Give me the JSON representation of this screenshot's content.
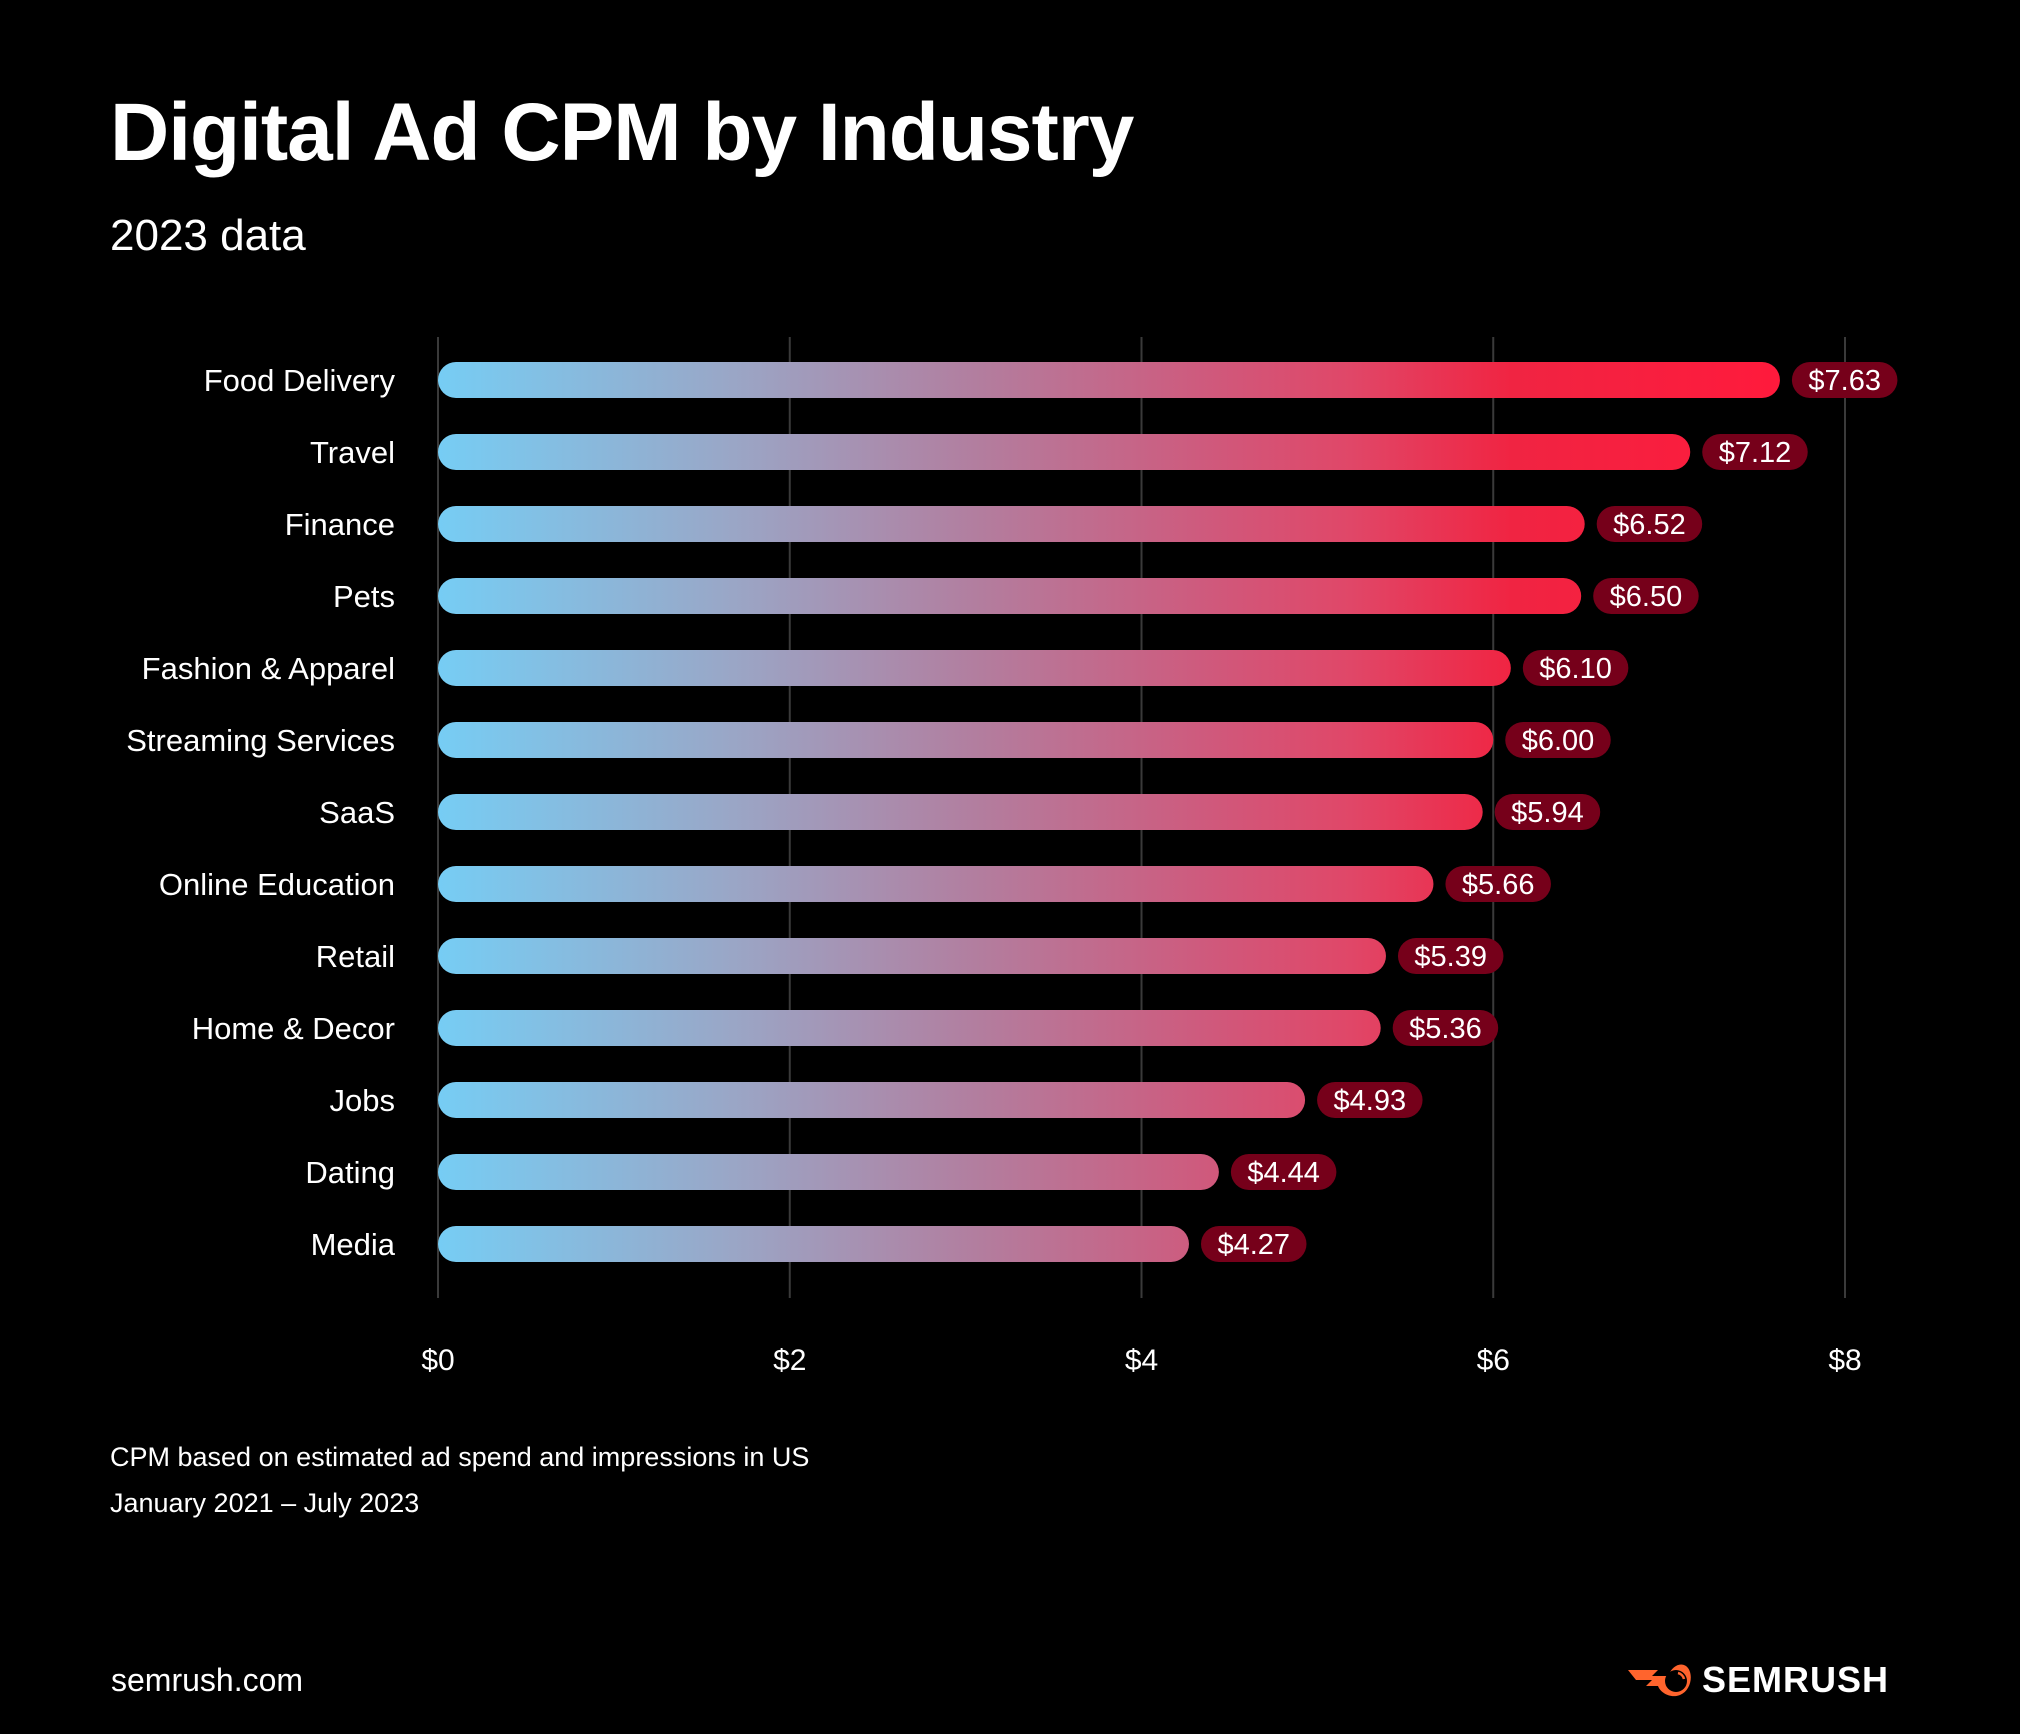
{
  "header": {
    "title": "Digital Ad CPM by Industry",
    "subtitle": "2023 data"
  },
  "chart_data": {
    "type": "bar",
    "orientation": "horizontal",
    "title": "Digital Ad CPM by Industry",
    "subtitle": "2023 data",
    "xlabel": "",
    "ylabel": "",
    "categories": [
      "Food Delivery",
      "Travel",
      "Finance",
      "Pets",
      "Fashion & Apparel",
      "Streaming Services",
      "SaaS",
      "Online Education",
      "Retail",
      "Home & Decor",
      "Jobs",
      "Dating",
      "Media"
    ],
    "values": [
      7.63,
      7.12,
      6.52,
      6.5,
      6.1,
      6.0,
      5.94,
      5.66,
      5.39,
      5.36,
      4.93,
      4.44,
      4.27
    ],
    "value_labels": [
      "$7.63",
      "$7.12",
      "$6.52",
      "$6.50",
      "$6.10",
      "$6.00",
      "$5.94",
      "$5.66",
      "$5.39",
      "$5.36",
      "$4.93",
      "$4.44",
      "$4.27"
    ],
    "xlim": [
      0,
      8
    ],
    "x_ticks": [
      0,
      2,
      4,
      6,
      8
    ],
    "x_tick_labels": [
      "$0",
      "$2",
      "$4",
      "$6",
      "$8"
    ],
    "grid": true,
    "legend": "none",
    "colors": {
      "gradient_start": "#76cdf4",
      "gradient_mid": "#b07fa0",
      "gradient_end": "#ff1a3c",
      "label_pill": "#76001a",
      "grid": "#3a3a3a"
    }
  },
  "footnotes": [
    "CPM based on estimated ad spend and impressions in US",
    "January 2021 – July 2023"
  ],
  "footer": {
    "site": "semrush.com",
    "brand": "SEMRUSH",
    "brand_color": "#ff642d"
  }
}
